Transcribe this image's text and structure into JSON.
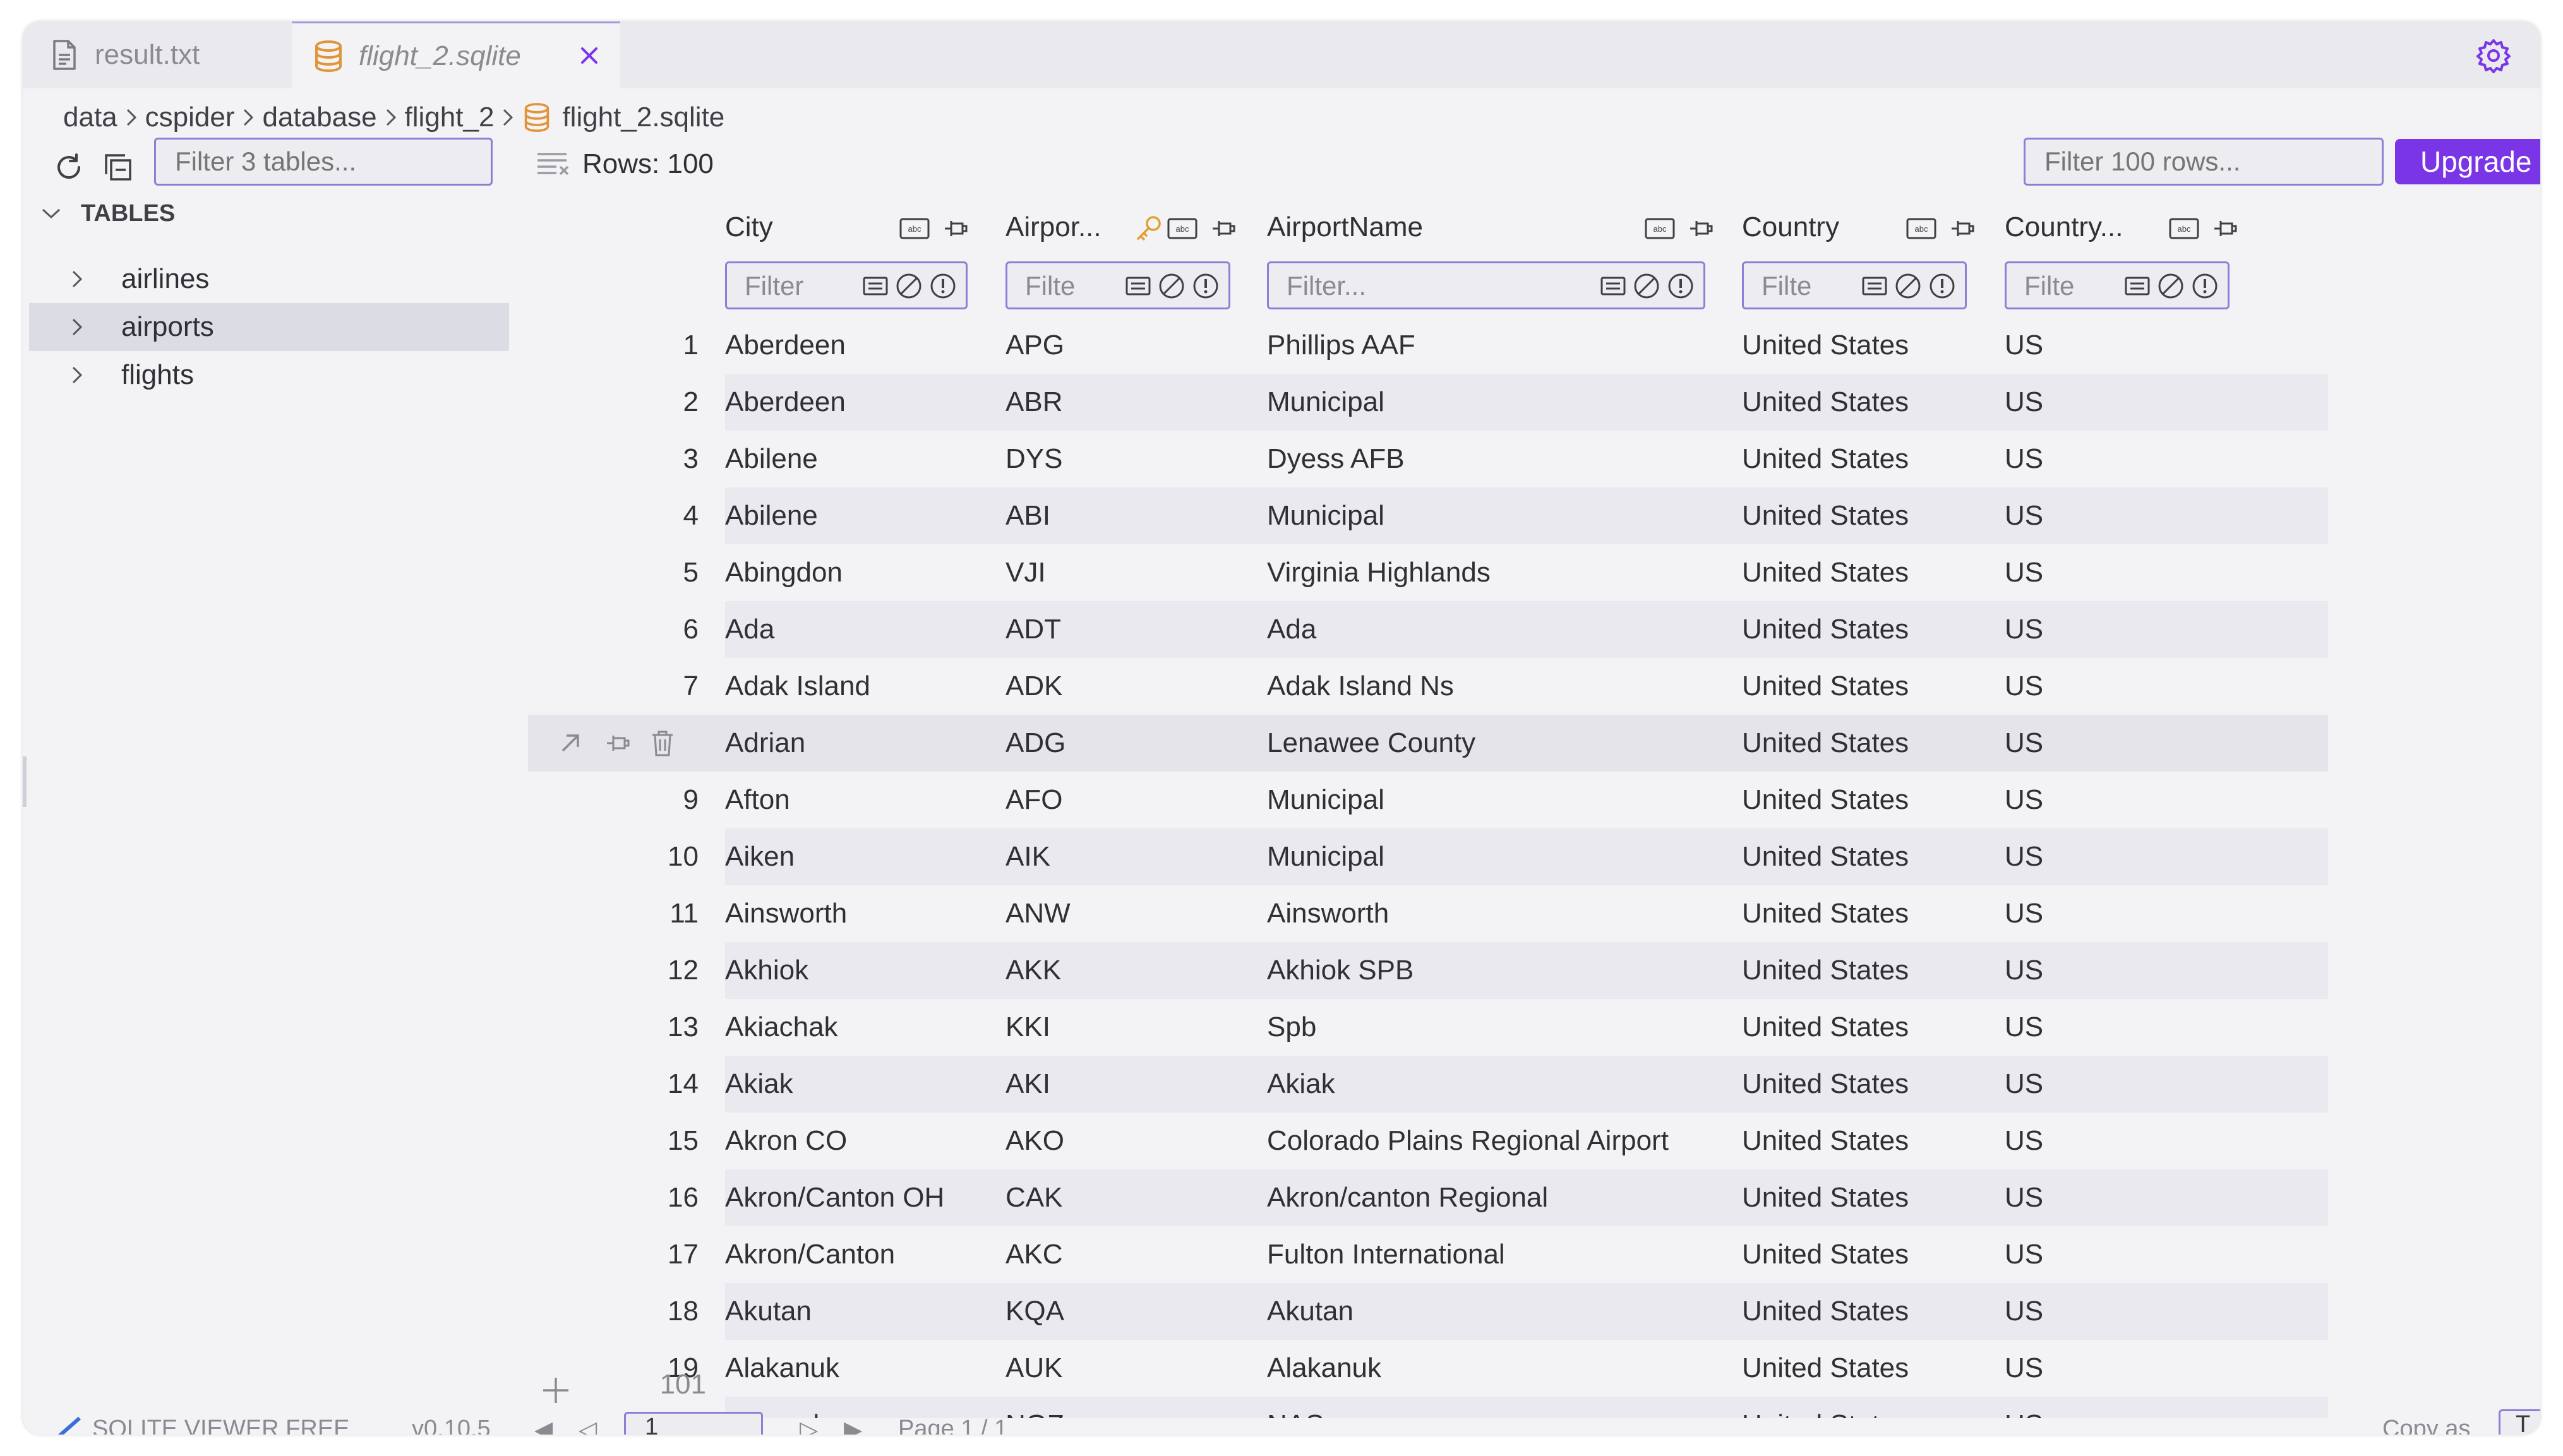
{
  "tabs": [
    {
      "label": "result.txt",
      "icon": "document-icon"
    },
    {
      "label": "flight_2.sqlite",
      "icon": "database-icon",
      "active": true
    }
  ],
  "breadcrumb": [
    "data",
    "cspider",
    "database",
    "flight_2",
    "flight_2.sqlite"
  ],
  "toolbar": {
    "table_filter_placeholder": "Filter 3 tables...",
    "rows_label": "Rows: 100",
    "row_filter_placeholder": "Filter 100 rows...",
    "upgrade_label": "Upgrade"
  },
  "sidebar": {
    "header": "TABLES",
    "items": [
      {
        "label": "airlines"
      },
      {
        "label": "airports",
        "selected": true
      },
      {
        "label": "flights"
      }
    ]
  },
  "columns": [
    {
      "label": "City",
      "filter_placeholder": "Filter"
    },
    {
      "label": "Airpor...",
      "filter_placeholder": "Filte",
      "key": true
    },
    {
      "label": "AirportName",
      "filter_placeholder": "Filter..."
    },
    {
      "label": "Country",
      "filter_placeholder": "Filte"
    },
    {
      "label": "Country...",
      "filter_placeholder": "Filte"
    }
  ],
  "rows": [
    {
      "n": "1",
      "city": "Aberdeen",
      "code": "APG",
      "name": "Phillips AAF",
      "country": "United States",
      "abbrev": "US"
    },
    {
      "n": "2",
      "city": "Aberdeen",
      "code": "ABR",
      "name": "Municipal",
      "country": "United States",
      "abbrev": "US"
    },
    {
      "n": "3",
      "city": "Abilene",
      "code": "DYS",
      "name": "Dyess AFB",
      "country": "United States",
      "abbrev": "US"
    },
    {
      "n": "4",
      "city": "Abilene",
      "code": "ABI",
      "name": "Municipal",
      "country": "United States",
      "abbrev": "US"
    },
    {
      "n": "5",
      "city": "Abingdon",
      "code": "VJI",
      "name": "Virginia Highlands",
      "country": "United States",
      "abbrev": "US"
    },
    {
      "n": "6",
      "city": "Ada",
      "code": "ADT",
      "name": "Ada",
      "country": "United States",
      "abbrev": "US"
    },
    {
      "n": "7",
      "city": "Adak Island",
      "code": "ADK",
      "name": "Adak Island Ns",
      "country": "United States",
      "abbrev": "US"
    },
    {
      "n": "",
      "city": "Adrian",
      "code": "ADG",
      "name": "Lenawee County",
      "country": "United States",
      "abbrev": "US",
      "hover": true
    },
    {
      "n": "9",
      "city": "Afton",
      "code": "AFO",
      "name": "Municipal",
      "country": "United States",
      "abbrev": "US"
    },
    {
      "n": "10",
      "city": "Aiken",
      "code": "AIK",
      "name": "Municipal",
      "country": "United States",
      "abbrev": "US"
    },
    {
      "n": "11",
      "city": "Ainsworth",
      "code": "ANW",
      "name": "Ainsworth",
      "country": "United States",
      "abbrev": "US"
    },
    {
      "n": "12",
      "city": "Akhiok",
      "code": "AKK",
      "name": "Akhiok SPB",
      "country": "United States",
      "abbrev": "US"
    },
    {
      "n": "13",
      "city": "Akiachak",
      "code": "KKI",
      "name": "Spb",
      "country": "United States",
      "abbrev": "US"
    },
    {
      "n": "14",
      "city": "Akiak",
      "code": "AKI",
      "name": "Akiak",
      "country": "United States",
      "abbrev": "US"
    },
    {
      "n": "15",
      "city": "Akron CO",
      "code": "AKO",
      "name": "Colorado Plains Regional Airport",
      "country": "United States",
      "abbrev": "US"
    },
    {
      "n": "16",
      "city": "Akron/Canton OH",
      "code": "CAK",
      "name": "Akron/canton Regional",
      "country": "United States",
      "abbrev": "US"
    },
    {
      "n": "17",
      "city": "Akron/Canton",
      "code": "AKC",
      "name": "Fulton International",
      "country": "United States",
      "abbrev": "US"
    },
    {
      "n": "18",
      "city": "Akutan",
      "code": "KQA",
      "name": "Akutan",
      "country": "United States",
      "abbrev": "US"
    },
    {
      "n": "19",
      "city": "Alakanuk",
      "code": "AUK",
      "name": "Alakanuk",
      "country": "United States",
      "abbrev": "US"
    },
    {
      "n": "",
      "city": "Alameda",
      "code": "NGZ",
      "name": "NAS",
      "country": "United States",
      "abbrev": "US"
    }
  ],
  "add_row_number": "101",
  "statusbar": {
    "product": "SQLITE VIEWER FREE",
    "version": "v0.10.5",
    "page_input": "1",
    "page_label": "Page 1 / 1",
    "copy_label": "Copy as",
    "copy_btn": "T"
  },
  "colors": {
    "accent": "#7a35e6",
    "filter_border": "#8e7fd6",
    "db_icon": "#e0953a",
    "key_icon": "#e0a030",
    "stripe": "#e9e9ef"
  }
}
